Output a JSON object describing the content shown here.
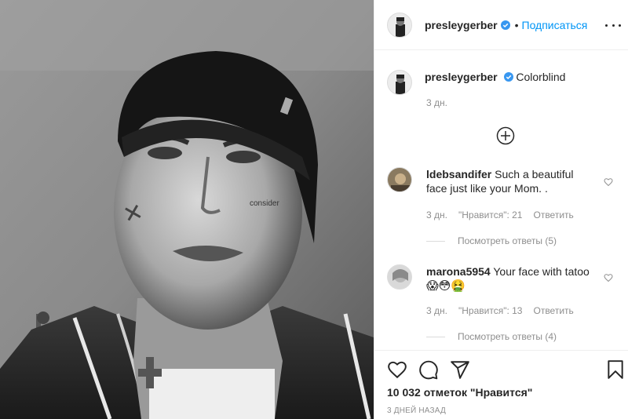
{
  "post": {
    "username": "presleygerber",
    "follow_label": "Подписаться",
    "dot": "•",
    "verified_icon": "verified-badge-icon",
    "more_icon": "more-options-icon"
  },
  "caption": {
    "username": "presleygerber",
    "text": "Colorblind",
    "time": "3 дн."
  },
  "comments": [
    {
      "username": "ldebsandifer",
      "text": "Such a beautiful face just like your Mom. .",
      "time": "3 дн.",
      "likes": "\"Нравится\": 21",
      "reply": "Ответить",
      "view_replies": "Посмотреть ответы (5)"
    },
    {
      "username": "marona5954",
      "text": "Your face with tatoo",
      "emojis": "😱😳🤮",
      "time": "3 дн.",
      "likes": "\"Нравится\": 13",
      "reply": "Ответить",
      "view_replies": "Посмотреть ответы (4)"
    }
  ],
  "actions": {
    "likes": "10 032 отметок \"Нравится\"",
    "date": "3 ДНЕЙ НАЗАД"
  },
  "colors": {
    "accent": "#0095f6",
    "verified": "#3897f0",
    "muted": "#8e8e8e"
  }
}
